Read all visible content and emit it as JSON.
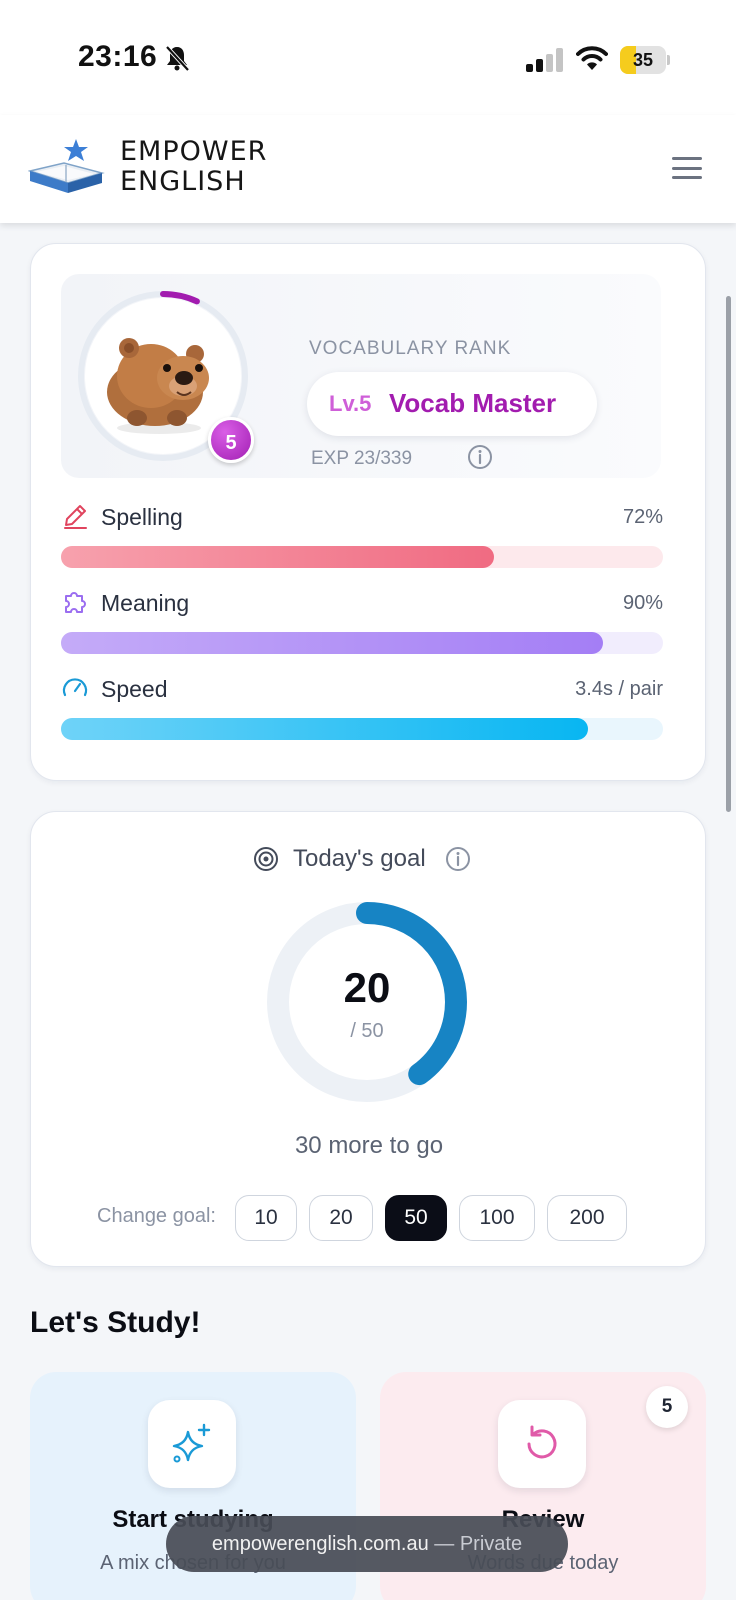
{
  "status_bar": {
    "time": "23:16",
    "battery_level": "35",
    "battery_color": "#f5cc1d"
  },
  "header": {
    "logo_line1": "EMPOWER",
    "logo_line2": "ENGLISH",
    "menu_icon": "hamburger-menu-icon"
  },
  "rank": {
    "label": "VOCABULARY RANK",
    "level": "Lv.5",
    "title": "Vocab Master",
    "badge": "5",
    "exp": "EXP 23/339",
    "exp_current": 23,
    "exp_max": 339,
    "accent_color": "#a21caf"
  },
  "stats": [
    {
      "label": "Spelling",
      "value": "72%",
      "fill": 0.72,
      "icon": "pencil-icon",
      "color": "#f06b82"
    },
    {
      "label": "Meaning",
      "value": "90%",
      "fill": 0.9,
      "icon": "puzzle-icon",
      "color": "#a47ef5"
    },
    {
      "label": "Speed",
      "value": "3.4s / pair",
      "fill": 0.876,
      "icon": "speedometer-icon",
      "color": "#18b4f0"
    }
  ],
  "goal": {
    "title": "Today's goal",
    "current": "20",
    "total": "/ 50",
    "progress": 0.4,
    "remaining": "30 more to go",
    "change_label": "Change goal:",
    "options": [
      "10",
      "20",
      "50",
      "100",
      "200"
    ],
    "selected": "50",
    "ring_color": "#1784c4"
  },
  "study": {
    "heading": "Let's Study!",
    "start_title": "Start studying",
    "start_sub": "A mix chosen for you",
    "review_title": "Review",
    "review_sub": "Words due today",
    "review_count": "5"
  },
  "browser": {
    "domain": "empowerenglish.com.au",
    "mode": "— Private"
  }
}
